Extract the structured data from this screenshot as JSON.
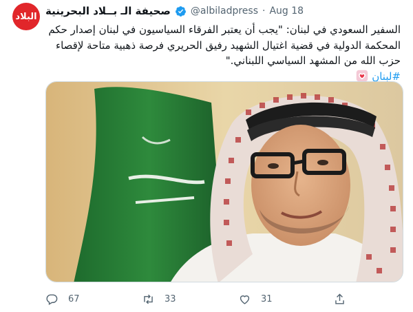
{
  "account": {
    "display_name": "صحيفة الـ بــلاد البحرينية",
    "avatar_text": "البلاد",
    "handle": "@albiladpress",
    "separator": "·",
    "date": "Aug 18"
  },
  "tweet": {
    "lines": [
      "السفير السعودي في لبنان: \"يجب أن يعتبر الفرقاء السياسيون في لبنان إصدار حكم",
      "المحكمة الدولية في قضية اغتيال الشهيد رفيق الحريري فرصة ذهبية متاحة لإقصاء",
      "حزب الله من المشهد السياسي اللبناني.\""
    ],
    "hashtag": "#لبنان"
  },
  "media": {
    "icon": "photo-of-ambassador"
  },
  "actions": {
    "reply_count": "67",
    "retweet_count": "33",
    "like_count": "31"
  },
  "colors": {
    "link": "#1d9bf0",
    "verified": "#1d9bf0",
    "secondary_text": "#536471",
    "avatar_bg": "#e1262a"
  }
}
